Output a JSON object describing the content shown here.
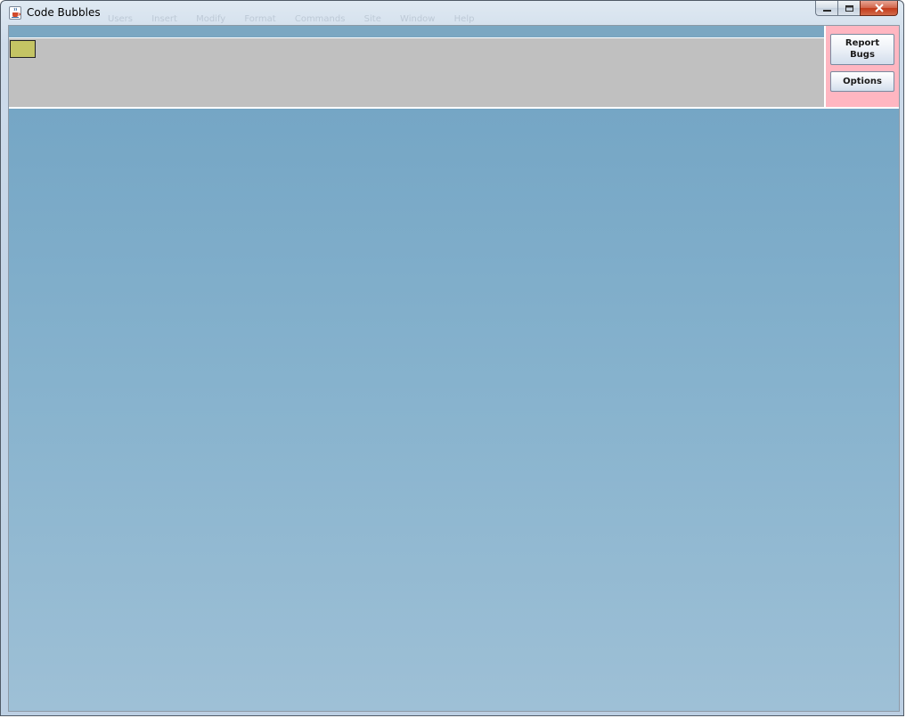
{
  "window": {
    "title": "Code Bubbles",
    "app_icon": "java-cup-icon",
    "controls": {
      "minimize_icon": "minimize-icon",
      "maximize_icon": "maximize-icon",
      "close_icon": "close-icon"
    }
  },
  "ghost_menu": {
    "items": [
      "Users",
      "Insert",
      "Modify",
      "Format",
      "Commands",
      "Site",
      "Window",
      "Help"
    ]
  },
  "panel": {
    "report_bugs_line1": "Report",
    "report_bugs_line2": "Bugs",
    "options_label": "Options"
  },
  "colors": {
    "topstrip": "#7ba7c2",
    "overview": "#c0c0c0",
    "viewport_box": "#c4c464",
    "right_panel": "#ffb6c1",
    "desk_top": "#75a6c5",
    "desk_bottom": "#9ec0d6"
  }
}
